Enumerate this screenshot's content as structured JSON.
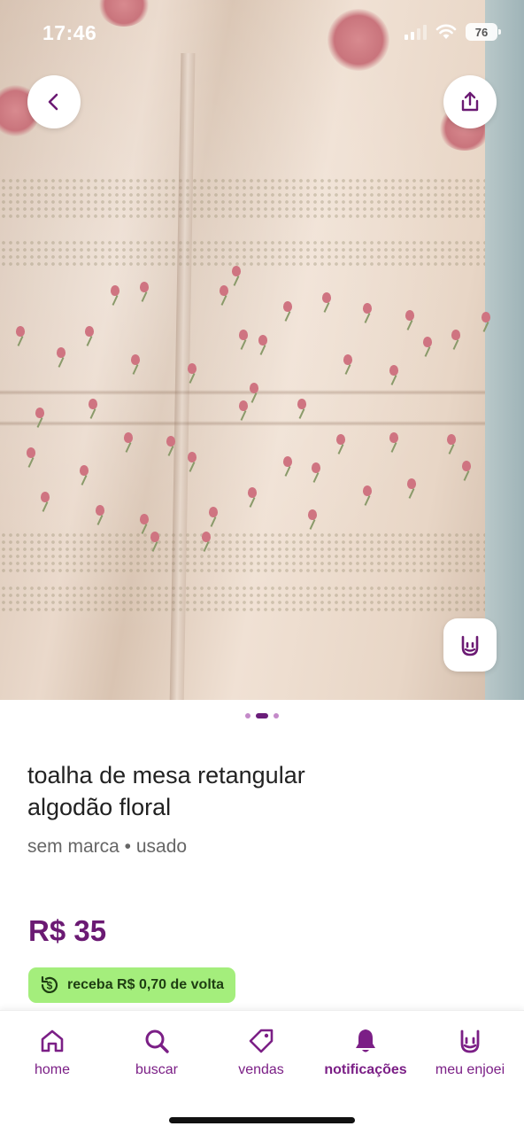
{
  "status_bar": {
    "time": "17:46",
    "battery": "76",
    "icons": [
      "signal-icon",
      "wifi-icon",
      "battery-icon"
    ]
  },
  "photo": {
    "carousel_total": 3,
    "carousel_active_index": 1,
    "buttons": {
      "back": "chevron-left-icon",
      "share": "share-icon",
      "enjoei": "rock-hand-icon"
    }
  },
  "product": {
    "title_line1": "toalha de mesa retangular",
    "title_line2": "algodão floral",
    "subtitle": "sem marca • usado",
    "price": "R$ 35",
    "cashback": "receba R$ 0,70 de volta"
  },
  "nav": {
    "items": [
      {
        "label": "home",
        "icon": "home-icon"
      },
      {
        "label": "buscar",
        "icon": "search-icon"
      },
      {
        "label": "vendas",
        "icon": "tag-icon"
      },
      {
        "label": "notificações",
        "icon": "bell-icon",
        "active": true
      },
      {
        "label": "meu enjoei",
        "icon": "rock-hand-icon"
      }
    ]
  },
  "colors": {
    "brand_purple": "#6b1a73",
    "nav_purple": "#7b1f86",
    "cashback_green": "#a4ee7c"
  }
}
